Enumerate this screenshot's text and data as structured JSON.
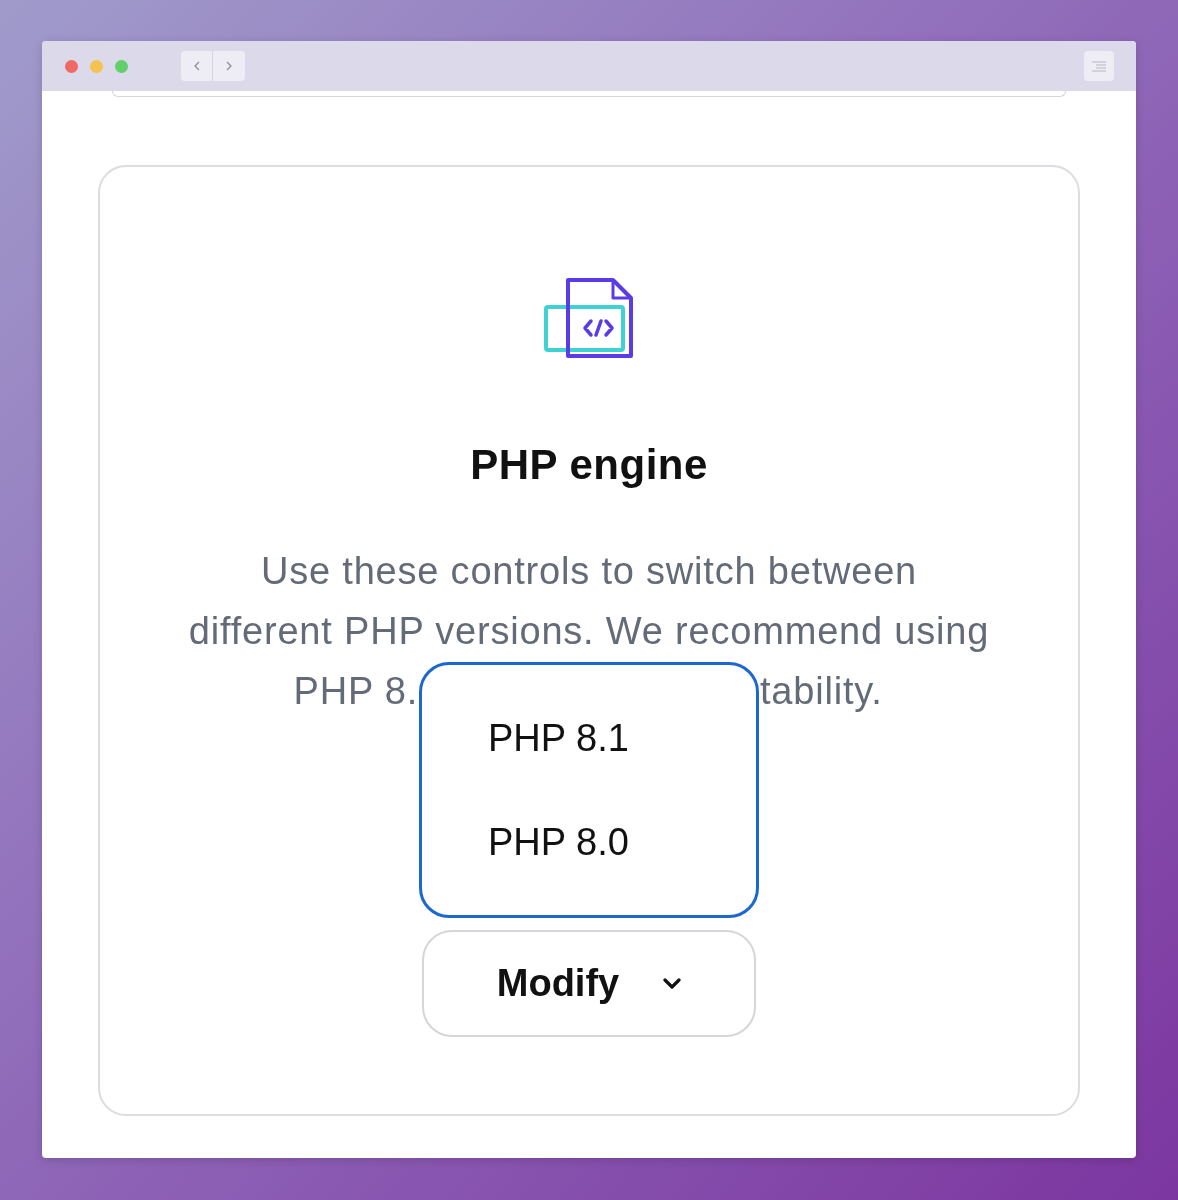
{
  "card": {
    "title": "PHP engine",
    "description": {
      "lines": [
        "Use these controls to switch between",
        "different PHP versions. We recommend using"
      ],
      "covered_line_start": "PHP 8.",
      "covered_line_end": "tability."
    },
    "version_menu": {
      "items": [
        {
          "label": "PHP 8.1",
          "selected": false
        },
        {
          "label": "PHP 8.0",
          "selected": false
        }
      ]
    },
    "modify_button": {
      "label": "Modify",
      "expanded": true
    }
  }
}
